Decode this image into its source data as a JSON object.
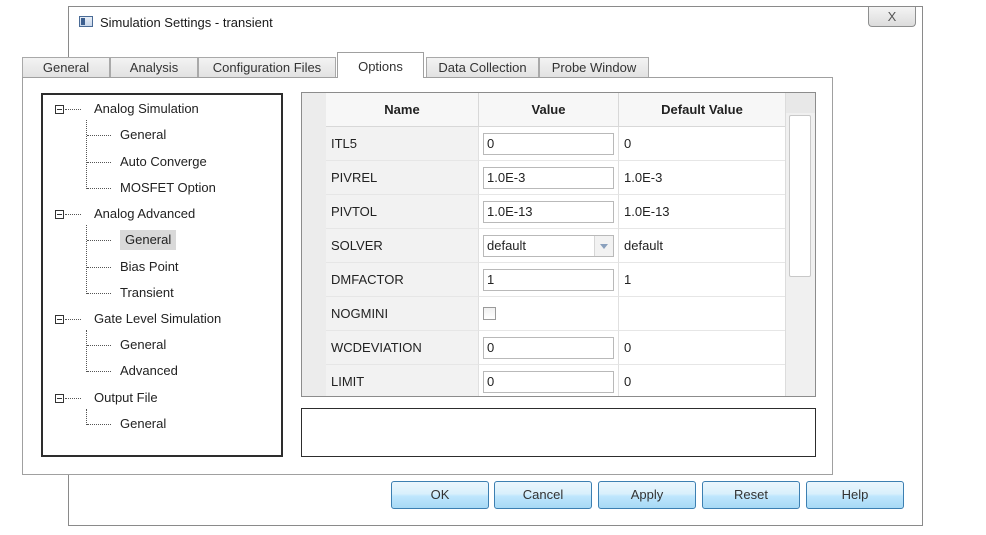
{
  "window": {
    "title": "Simulation Settings - transient",
    "close_icon": "close-icon",
    "close_glyph": "X"
  },
  "tabs": [
    {
      "label": "General"
    },
    {
      "label": "Analysis"
    },
    {
      "label": "Configuration Files"
    },
    {
      "label": "Options",
      "active": true
    },
    {
      "label": "Data Collection"
    },
    {
      "label": "Probe Window"
    }
  ],
  "tree": {
    "groups": [
      {
        "label": "Analog Simulation",
        "children": [
          "General",
          "Auto Converge",
          "MOSFET Option"
        ]
      },
      {
        "label": "Analog Advanced",
        "children": [
          "General",
          "Bias Point",
          "Transient"
        ],
        "selected_child": 0
      },
      {
        "label": "Gate Level Simulation",
        "children": [
          "General",
          "Advanced"
        ]
      },
      {
        "label": "Output File",
        "children": [
          "General"
        ]
      }
    ]
  },
  "grid": {
    "headers": {
      "name": "Name",
      "value": "Value",
      "default": "Default Value"
    },
    "rows": [
      {
        "name": "ITL5",
        "kind": "text",
        "value": "0",
        "default": "0"
      },
      {
        "name": "PIVREL",
        "kind": "text",
        "value": "1.0E-3",
        "default": "1.0E-3"
      },
      {
        "name": "PIVTOL",
        "kind": "text",
        "value": "1.0E-13",
        "default": "1.0E-13"
      },
      {
        "name": "SOLVER",
        "kind": "select",
        "value": "default",
        "default": "default"
      },
      {
        "name": "DMFACTOR",
        "kind": "text",
        "value": "1",
        "default": "1"
      },
      {
        "name": "NOGMINI",
        "kind": "checkbox",
        "value": "",
        "default": ""
      },
      {
        "name": "WCDEVIATION",
        "kind": "text",
        "value": "0",
        "default": "0"
      },
      {
        "name": "LIMIT",
        "kind": "text",
        "value": "0",
        "default": "0"
      }
    ]
  },
  "buttons": {
    "ok": "OK",
    "cancel": "Cancel",
    "apply": "Apply",
    "reset": "Reset",
    "help": "Help"
  }
}
